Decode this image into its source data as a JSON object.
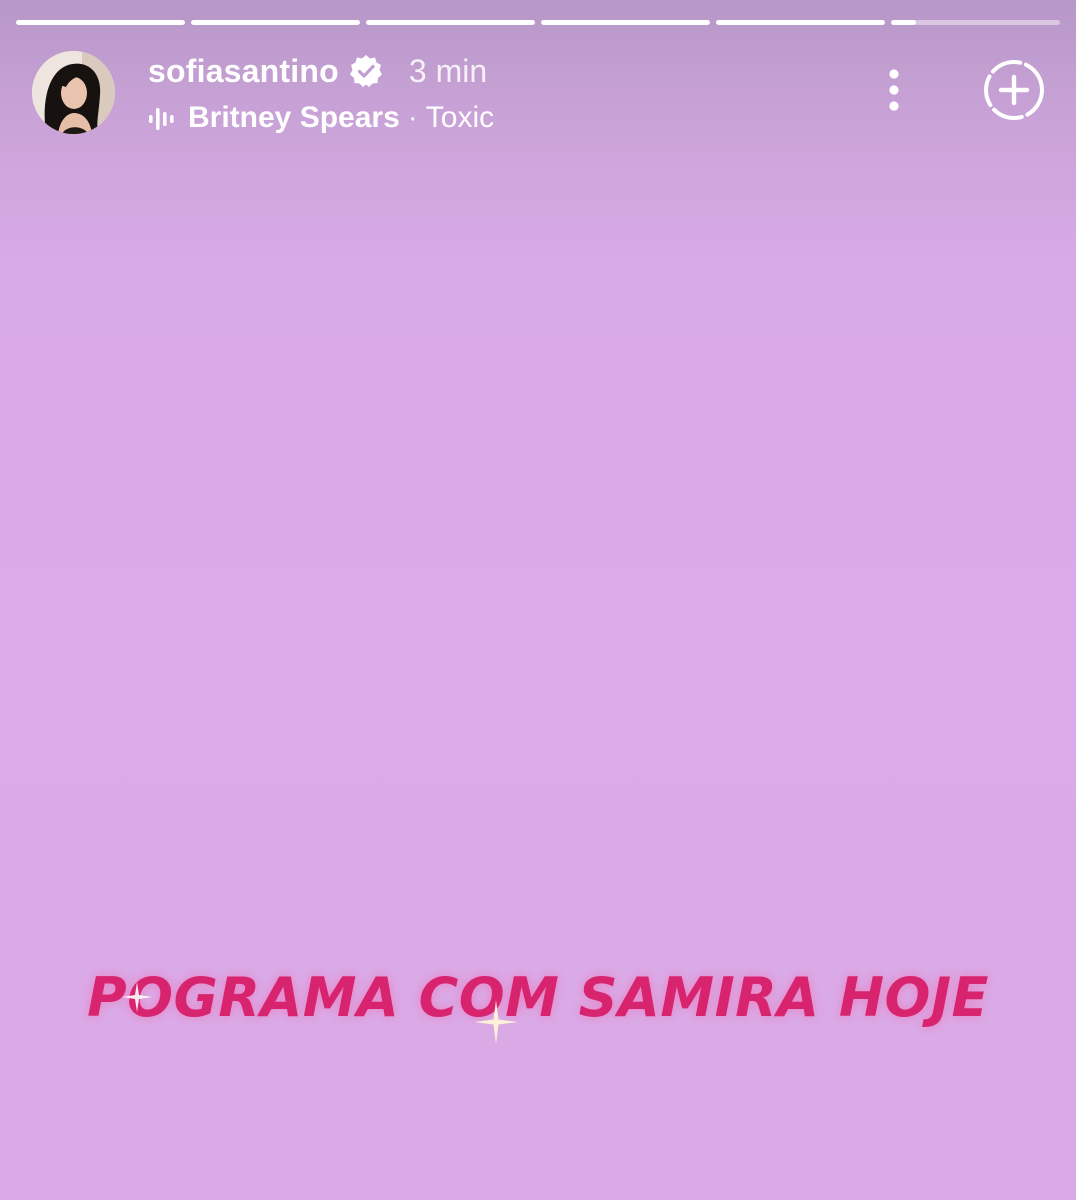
{
  "story": {
    "segments": [
      1,
      1,
      1,
      1,
      1,
      0.15
    ],
    "colors": {
      "caption": "#d8246e",
      "background": "#dbaae8"
    }
  },
  "header": {
    "username": "sofiasantino",
    "time_ago": "3 min",
    "verified_icon": "verified-badge-icon",
    "music": {
      "artist": "Britney Spears",
      "separator": "·",
      "song": "Toxic"
    },
    "more_icon": "more-vertical-icon",
    "add_icon": "add-circle-icon"
  },
  "caption": {
    "text": "POGRAMA COM SAMIRA HOJE"
  }
}
